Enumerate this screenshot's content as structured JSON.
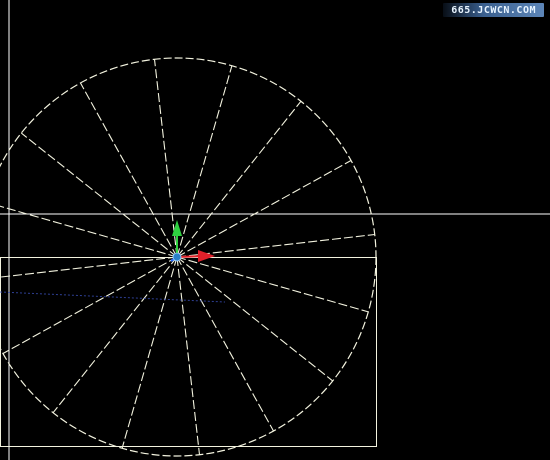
{
  "app": {
    "background": "#000000",
    "watermark": "665.JCWCN.COM"
  },
  "drawing": {
    "line_color": "#f3f3df",
    "crosshair_color": "#ffffff",
    "gizmo": {
      "x_axis_color": "#e0202a",
      "y_axis_color": "#2fd040",
      "z_axis_color": "#2a6cff",
      "origin_color": "#2a80c8"
    },
    "spoke_count": 16
  }
}
